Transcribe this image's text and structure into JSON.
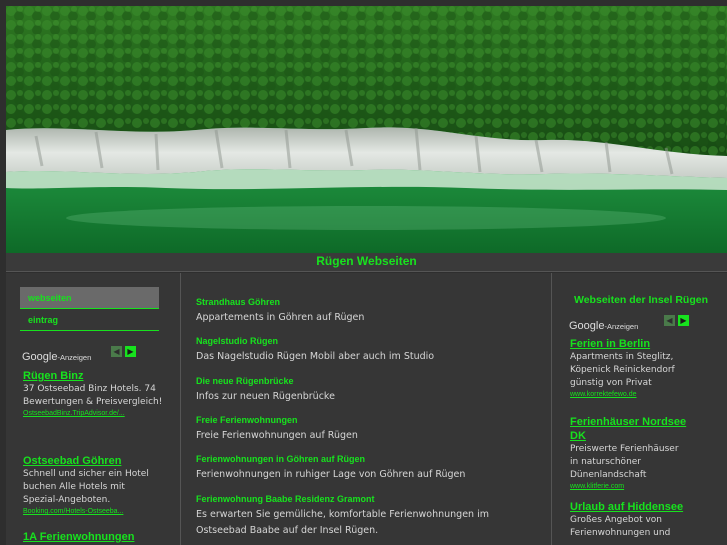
{
  "hero": {
    "colors": {
      "forest": "#2f7d25",
      "cliff": "#d6dad6",
      "water": "#1f9a45",
      "shallow": "#8fd8a8"
    }
  },
  "site": {
    "title": "Rügen Webseiten",
    "accent": "#17e21e"
  },
  "menu": [
    {
      "label": "webseiten",
      "active": true
    },
    {
      "label": "eintrag",
      "active": false
    }
  ],
  "google": {
    "logo": "Google",
    "anzeigen": "-Anzeigen",
    "prev_icon": "chevron-left-icon",
    "next_icon": "chevron-right-icon"
  },
  "left_ads": [
    {
      "title": "Rügen Binz",
      "text": "37 Ostseebad Binz Hotels. 74 Bewertungen & Preisvergleich!",
      "url": "OstseebadBinz.TripAdvisor.de/..."
    },
    {
      "title": "Ostseebad Göhren",
      "text": "Schnell und sicher ein Hotel buchen Alle Hotels mit Spezial-Angeboten.",
      "url": "Booking.com/Hotels-Ostseeba..."
    },
    {
      "title": "1A Ferienwohnungen",
      "text": "",
      "url": ""
    }
  ],
  "entries": [
    {
      "title": "Strandhaus Göhren",
      "desc": "Appartements in Göhren auf Rügen"
    },
    {
      "title": "Nagelstudio Rügen",
      "desc": "Das Nagelstudio Rügen Mobil aber auch im Studio"
    },
    {
      "title": "Die neue Rügenbrücke",
      "desc": "Infos zur neuen Rügenbrücke"
    },
    {
      "title": "Freie Ferienwohnungen",
      "desc": "Freie Ferienwohnungen auf Rügen"
    },
    {
      "title": "Ferienwohnungen in Göhren auf Rügen",
      "desc": "Ferienwohnungen in ruhiger Lage von Göhren auf Rügen"
    },
    {
      "title": "Ferienwohnung Baabe Residenz Gramont",
      "desc": "Es erwarten Sie gemüliche, komfortable Ferienwohnungen im Ostseebad Baabe auf der Insel Rügen."
    }
  ],
  "right": {
    "heading": "Webseiten der Insel Rügen",
    "ads": [
      {
        "title": "Ferien in Berlin",
        "text": "Apartments in Steglitz, Köpenick Reinickendorf günstig von Privat",
        "url": "www.korrektefewo.de"
      },
      {
        "title": "Ferienhäuser Nordsee DK",
        "text": "Preiswerte Ferienhäuser in naturschöner Dünenlandschaft",
        "url": "www.klitferie.com"
      },
      {
        "title": "Urlaub auf Hiddensee",
        "text": "Großes Angebot von Ferienwohnungen und",
        "url": ""
      }
    ]
  }
}
